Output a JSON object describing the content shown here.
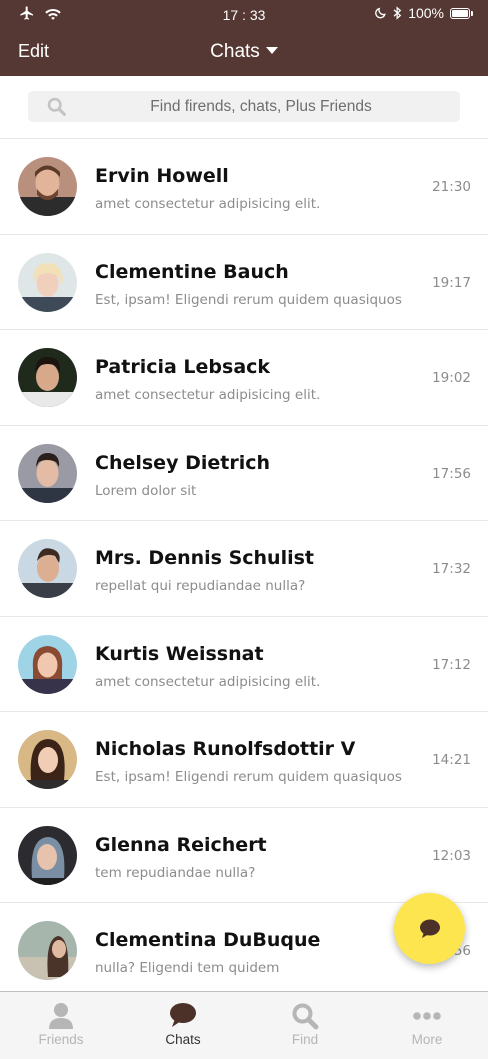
{
  "status_bar": {
    "time": "17 : 33",
    "battery": "100%"
  },
  "header": {
    "edit_label": "Edit",
    "title": "Chats"
  },
  "search": {
    "placeholder": "Find firends, chats, Plus Friends"
  },
  "chats": [
    {
      "name": "Ervin Howell",
      "preview": "amet consectetur adipisicing elit.",
      "time": "21:30"
    },
    {
      "name": "Clementine Bauch",
      "preview": "Est, ipsam! Eligendi rerum quidem quasiquos",
      "time": "19:17"
    },
    {
      "name": "Patricia Lebsack",
      "preview": "amet consectetur adipisicing elit.",
      "time": "19:02"
    },
    {
      "name": "Chelsey Dietrich",
      "preview": "Lorem dolor sit",
      "time": "17:56"
    },
    {
      "name": "Mrs. Dennis Schulist",
      "preview": "repellat qui repudiandae nulla?",
      "time": "17:32"
    },
    {
      "name": "Kurtis Weissnat",
      "preview": "amet consectetur adipisicing elit.",
      "time": "17:12"
    },
    {
      "name": "Nicholas Runolfsdottir V",
      "preview": "Est, ipsam! Eligendi rerum quidem quasiquos",
      "time": "14:21"
    },
    {
      "name": "Glenna Reichert",
      "preview": "tem repudiandae nulla?",
      "time": "12:03"
    },
    {
      "name": "Clementina DuBuque",
      "preview": "nulla? Eligendi tem quidem",
      "time": "11:56"
    }
  ],
  "tabs": [
    {
      "label": "Friends",
      "icon": "person-icon",
      "active": false
    },
    {
      "label": "Chats",
      "icon": "chat-bubble-icon",
      "active": true
    },
    {
      "label": "Find",
      "icon": "search-icon",
      "active": false
    },
    {
      "label": "More",
      "icon": "more-dots-icon",
      "active": false
    }
  ],
  "colors": {
    "header_bg": "#553833",
    "fab_bg": "#fce54f",
    "active_tab": "#333333",
    "inactive_tab": "#b6b6b6"
  }
}
